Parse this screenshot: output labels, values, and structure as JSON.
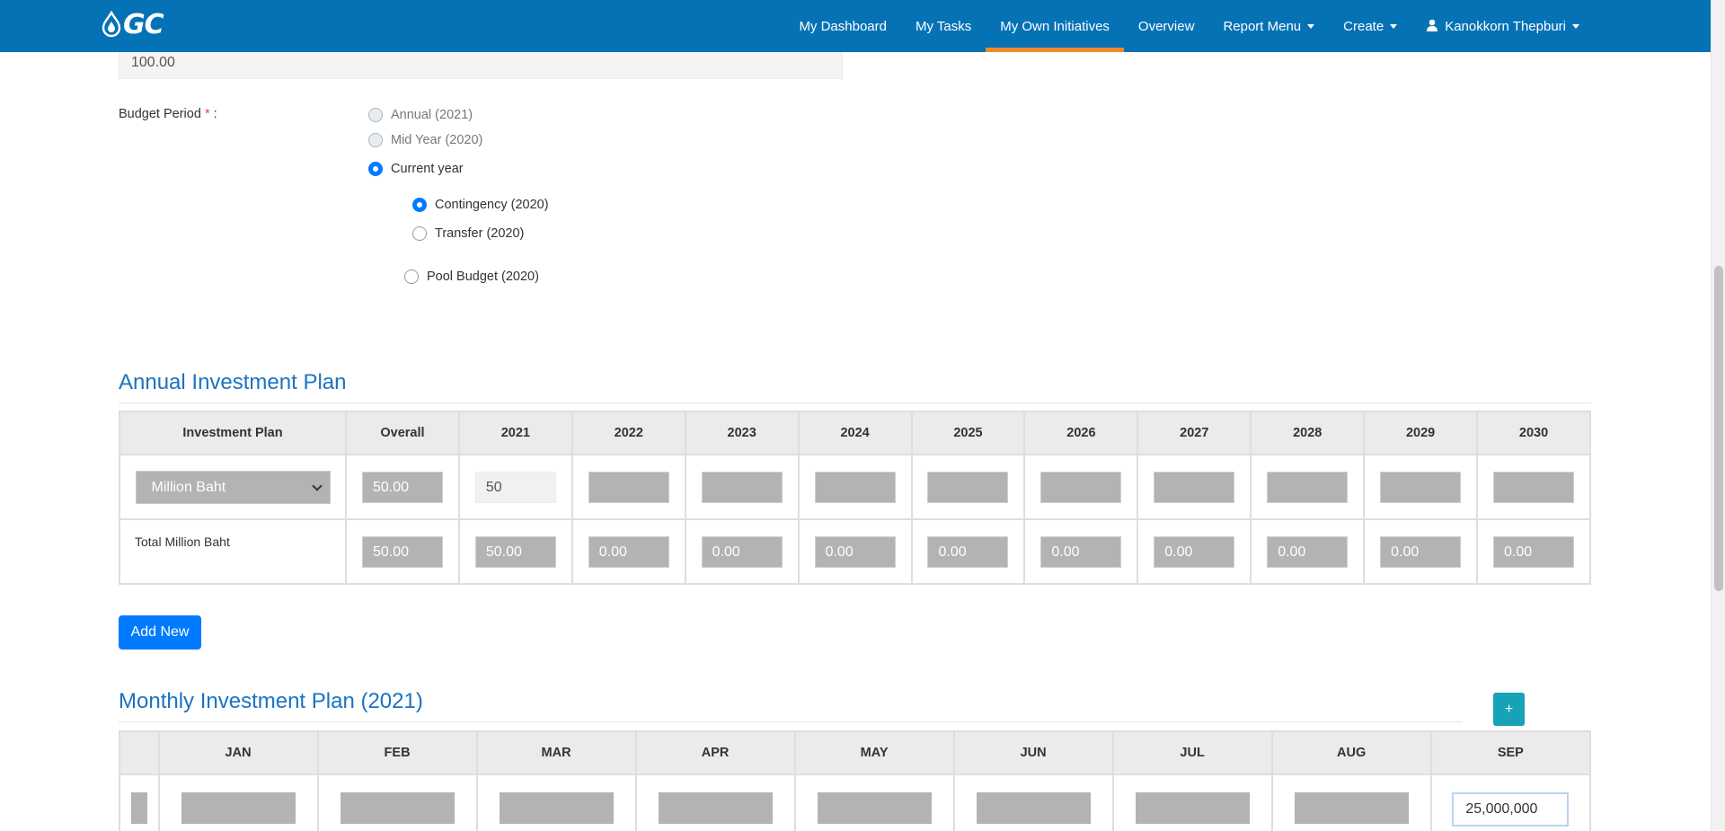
{
  "navbar": {
    "logo_text": "GC",
    "items": [
      {
        "label": "My Dashboard"
      },
      {
        "label": "My Tasks"
      },
      {
        "label": "My Own Initiatives"
      },
      {
        "label": "Overview"
      },
      {
        "label": "Report Menu"
      },
      {
        "label": "Create"
      }
    ],
    "active_item": "My Own Initiatives",
    "user_name": "Kanokkorn Thepburi",
    "accent_color": "#f08a24",
    "bar_color": "#0672b6"
  },
  "budget": {
    "value": "100.00",
    "period_label": "Budget Period",
    "required_mark": "*",
    "colon": ":",
    "options": {
      "annual": "Annual (2021)",
      "mid_year": "Mid Year (2020)",
      "current_year": "Current year",
      "contingency": "Contingency (2020)",
      "transfer": "Transfer (2020)",
      "pool_budget": "Pool Budget (2020)"
    },
    "selected": [
      "Current year",
      "Contingency (2020)"
    ]
  },
  "annual": {
    "title": "Annual Investment Plan",
    "headers": {
      "plan": "Investment Plan",
      "overall": "Overall",
      "y2021": "2021",
      "y2022": "2022",
      "y2023": "2023",
      "y2024": "2024",
      "y2025": "2025",
      "y2026": "2026",
      "y2027": "2027",
      "y2028": "2028",
      "y2029": "2029",
      "y2030": "2030"
    },
    "row1": {
      "currency": "Million Baht",
      "overall": "50.00",
      "y2021": "50"
    },
    "row2": {
      "label": "Total Million Baht",
      "overall": "50.00",
      "y2021": "50.00",
      "y2022": "0.00",
      "y2023": "0.00",
      "y2024": "0.00",
      "y2025": "0.00",
      "y2026": "0.00",
      "y2027": "0.00",
      "y2028": "0.00",
      "y2029": "0.00",
      "y2030": "0.00"
    },
    "add_button": "Add New"
  },
  "monthly": {
    "title": "Monthly Investment Plan (2021)",
    "plus_button": "+",
    "months": {
      "jan": "JAN",
      "feb": "FEB",
      "mar": "MAR",
      "apr": "APR",
      "may": "MAY",
      "jun": "JUN",
      "jul": "JUL",
      "aug": "AUG",
      "sep": "SEP"
    },
    "sep_value": "25,000,000"
  }
}
